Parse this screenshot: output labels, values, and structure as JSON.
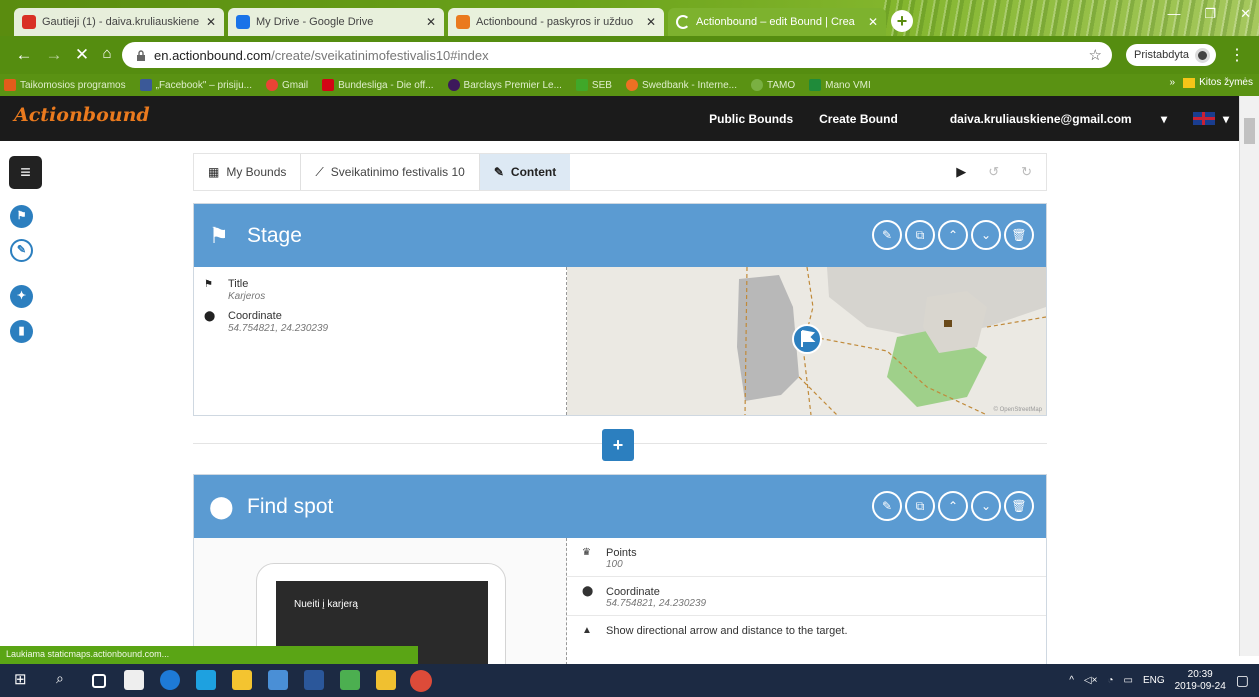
{
  "browser": {
    "tabs": [
      {
        "label": "Gautieji (1) - daiva.kruliauskiene@",
        "favicon_color": "#d93025"
      },
      {
        "label": "My Drive - Google Drive",
        "favicon_color": "#1a73e8"
      },
      {
        "label": "Actionbound - paskyros ir užduo",
        "favicon_color": "#ea7a1e"
      },
      {
        "label": "Actionbound – edit Bound | Crea",
        "favicon_color": "#ffffff"
      }
    ],
    "url_domain": "en.actionbound.com",
    "url_path": "/create/sveikatinimofestivalis10#index",
    "profile_label": "Pristabdyta",
    "bookmarks": [
      {
        "label": "Taikomosios programos",
        "color": "#e25c1b"
      },
      {
        "label": "„Facebook\" – prisiju...",
        "color": "#3b5998"
      },
      {
        "label": "Gmail",
        "color": "#ea4335"
      },
      {
        "label": "Bundesliga - Die off...",
        "color": "#d20515"
      },
      {
        "label": "Barclays Premier Le...",
        "color": "#3d195b"
      },
      {
        "label": "SEB",
        "color": "#40a829"
      },
      {
        "label": "Swedbank - Interne...",
        "color": "#ee7023"
      },
      {
        "label": "TAMO",
        "color": "#7ab042"
      },
      {
        "label": "Mano VMI",
        "color": "#1f8b3a"
      }
    ],
    "other_bookmarks": "Kitos žymės"
  },
  "app": {
    "logo": "Actionbound",
    "nav": {
      "public": "Public Bounds",
      "create": "Create Bound",
      "user": "daiva.kruliauskiene@gmail.com"
    }
  },
  "breadcrumb": {
    "my_bounds": "My Bounds",
    "bound": "Sveikatinimo festivalis 10",
    "current": "Content"
  },
  "stage": {
    "header": "Stage",
    "title_label": "Title",
    "title_value": "Karjeros",
    "coord_label": "Coordinate",
    "coord_value": "54.754821, 24.230239"
  },
  "find_spot": {
    "header": "Find spot",
    "phone_text": "Nueiti į karjerą",
    "points_label": "Points",
    "points_value": "100",
    "coord_label": "Coordinate",
    "coord_value": "54.754821, 24.230239",
    "arrow_text": "Show directional arrow and distance to the target."
  },
  "status_text": "Laukiama staticmaps.actionbound.com...",
  "taskbar": {
    "lang": "ENG",
    "time": "20:39",
    "date": "2019-09-24"
  },
  "colors": {
    "header_bg": "#1b1b1b",
    "logo": "#ea7a1e",
    "card_header": "#5b9bd2",
    "accent_blue": "#2c7fbf",
    "chrome_green": "#558d10"
  }
}
